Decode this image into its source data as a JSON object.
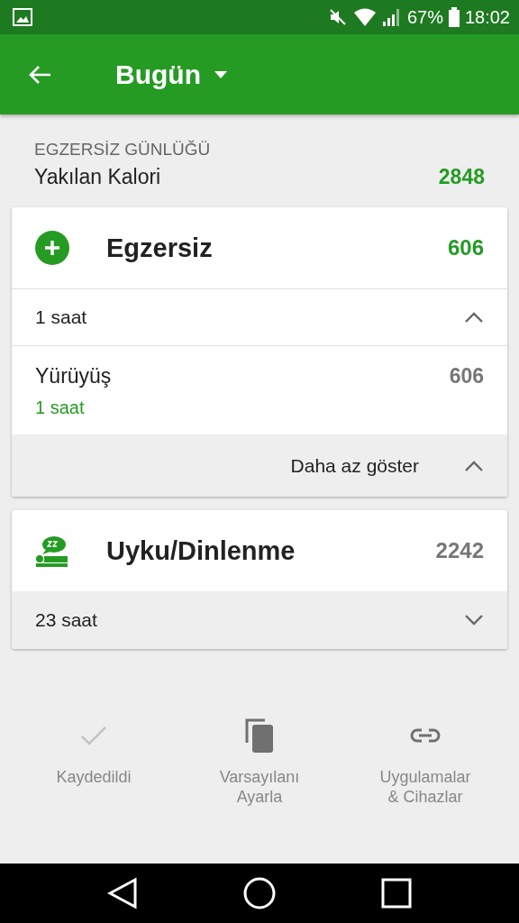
{
  "status_bar": {
    "battery": "67%",
    "time": "18:02"
  },
  "app_bar": {
    "title": "Bugün"
  },
  "summary": {
    "section_label": "EGZERSİZ GÜNLÜĞÜ",
    "label": "Yakılan Kalori",
    "value": "2848"
  },
  "cards": [
    {
      "kind": "exercise",
      "title": "Egzersiz",
      "value": "606",
      "subtitle": "1 saat",
      "expanded": true,
      "entries": [
        {
          "name": "Yürüyüş",
          "value": "606",
          "duration": "1 saat"
        }
      ],
      "footer_link": "Daha az göster"
    },
    {
      "kind": "sleep",
      "title": "Uyku/Dinlenme",
      "value": "2242",
      "subtitle": "23 saat",
      "expanded": false
    }
  ],
  "actions": [
    {
      "kind": "check",
      "label": "Kaydedildi",
      "disabled": true
    },
    {
      "kind": "copy",
      "label": "Varsayılanı Ayarla",
      "disabled": false
    },
    {
      "kind": "link",
      "label": "Uygulamalar & Cihazlar",
      "disabled": false
    }
  ]
}
